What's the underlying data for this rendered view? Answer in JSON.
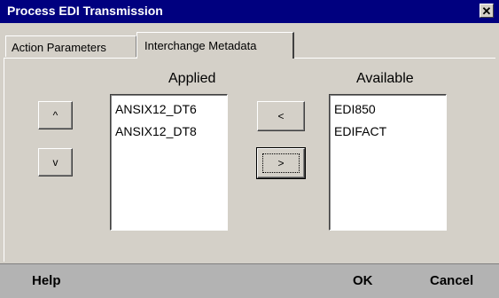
{
  "window": {
    "title": "Process EDI Transmission",
    "close_glyph": "✕"
  },
  "tabs": [
    {
      "label": "Action Parameters"
    },
    {
      "label": "Interchange Metadata"
    }
  ],
  "applied": {
    "header": "Applied",
    "items": [
      "ANSIX12_DT6",
      "ANSIX12_DT8"
    ]
  },
  "available": {
    "header": "Available",
    "items": [
      "EDI850",
      "EDIFACT"
    ]
  },
  "buttons": {
    "up": "^",
    "down": "v",
    "left": "<",
    "right": ">"
  },
  "footer": {
    "help": "Help",
    "ok": "OK",
    "cancel": "Cancel"
  },
  "colors": {
    "titlebar": "#00007f",
    "panel": "#d4d0c8",
    "footer": "#b3b3b3"
  },
  "icons": {
    "close": "close-icon"
  }
}
